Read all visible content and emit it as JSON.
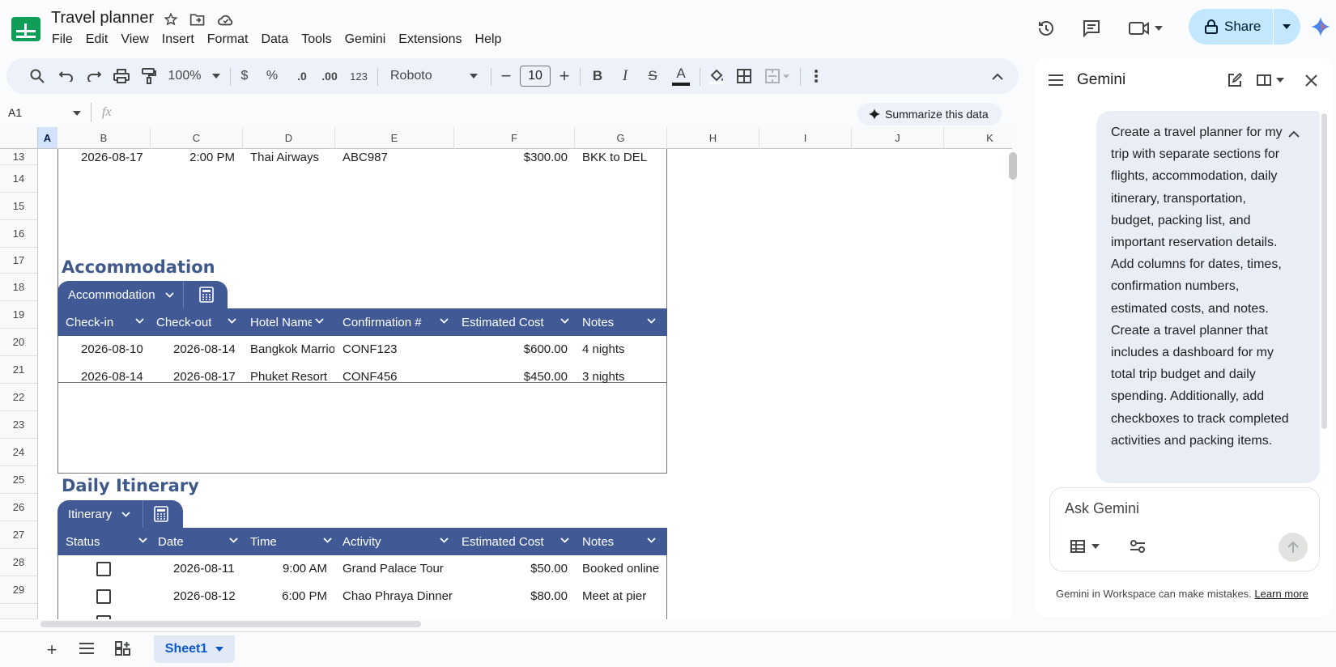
{
  "app": {
    "title": "Travel planner",
    "menus": [
      "File",
      "Edit",
      "View",
      "Insert",
      "Format",
      "Data",
      "Tools",
      "Gemini",
      "Extensions",
      "Help"
    ],
    "share_label": "Share"
  },
  "toolbar": {
    "zoom": "100%",
    "currency": "$",
    "percent": "%",
    "dec_decrease": ".0",
    "dec_increase": ".00",
    "number_format": "123",
    "font": "Roboto",
    "font_size": "10"
  },
  "formula_bar": {
    "cell_ref": "A1",
    "fx": "fx",
    "summarize_label": "Summarize this data"
  },
  "grid": {
    "columns": [
      "A",
      "B",
      "C",
      "D",
      "E",
      "F",
      "G",
      "H",
      "I",
      "J",
      "K"
    ],
    "rows": [
      "13",
      "14",
      "15",
      "16",
      "17",
      "18",
      "19",
      "20",
      "21",
      "22",
      "23",
      "24",
      "25",
      "26",
      "27",
      "28",
      "29"
    ],
    "flight_row": {
      "date": "2026-08-17",
      "time": "2:00 PM",
      "airline": "Thai Airways",
      "conf": "ABC987",
      "cost": "$300.00",
      "notes": "BKK to DEL"
    },
    "accommodation": {
      "title": "Accommodation",
      "tab_label": "Accommodation",
      "headers": [
        "Check-in",
        "Check-out",
        "Hotel Name",
        "Confirmation #",
        "Estimated Cost",
        "Notes"
      ],
      "rows": [
        {
          "checkin": "2026-08-10",
          "checkout": "2026-08-14",
          "hotel": "Bangkok Marriott",
          "conf": "CONF123",
          "cost": "$600.00",
          "notes": "4 nights"
        },
        {
          "checkin": "2026-08-14",
          "checkout": "2026-08-17",
          "hotel": "Phuket Resort",
          "conf": "CONF456",
          "cost": "$450.00",
          "notes": "3 nights"
        }
      ]
    },
    "itinerary": {
      "title": "Daily Itinerary",
      "tab_label": "Itinerary",
      "headers": [
        "Status",
        "Date",
        "Time",
        "Activity",
        "Estimated Cost",
        "Notes"
      ],
      "rows": [
        {
          "date": "2026-08-11",
          "time": "9:00 AM",
          "activity": "Grand Palace Tour",
          "cost": "$50.00",
          "notes": "Booked online"
        },
        {
          "date": "2026-08-12",
          "time": "6:00 PM",
          "activity": "Chao Phraya Dinner Cruise",
          "cost": "$80.00",
          "notes": "Meet at pier"
        }
      ]
    }
  },
  "sheets": {
    "active": "Sheet1"
  },
  "gemini": {
    "title": "Gemini",
    "prompt": "Create a travel planner for my trip with separate sections for flights, accommodation, daily itinerary, transportation, budget, packing list, and important reservation details. Add columns for dates, times, confirmation numbers, estimated costs, and notes. Create a travel planner that includes a dashboard for my total trip budget and daily spending. Additionally, add checkboxes to track completed activities and packing items.",
    "input_placeholder": "Ask Gemini",
    "disclaimer": "Gemini in Workspace can make mistakes.",
    "learn_more": "Learn more"
  }
}
